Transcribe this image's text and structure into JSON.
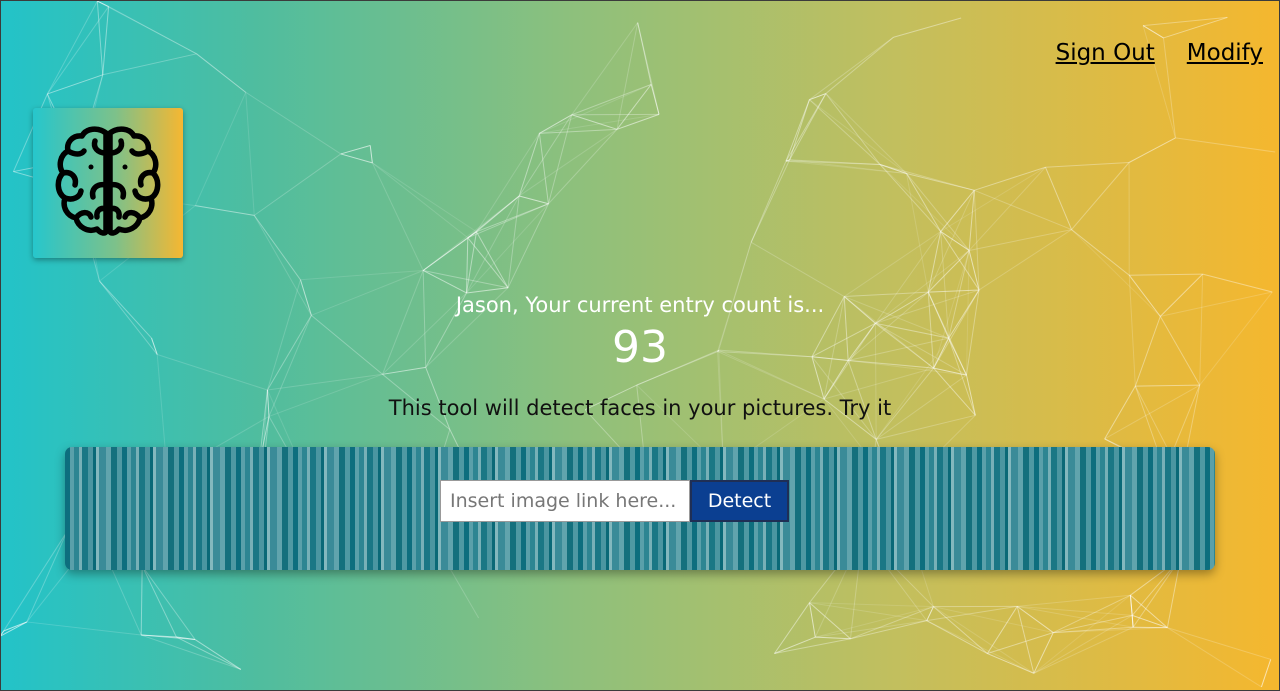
{
  "navigation": {
    "sign_out_label": "Sign Out",
    "modify_label": "Modify"
  },
  "logo": {
    "icon": "brain-icon"
  },
  "rank": {
    "message": "Jason, Your current entry count is...",
    "entries": "93"
  },
  "description": "This tool will detect faces in your pictures. Try it",
  "image_form": {
    "placeholder": "Insert image link here...",
    "value": "",
    "button_label": "Detect"
  },
  "colors": {
    "gradient_start": "#22c3c9",
    "gradient_end": "#f5b72e",
    "button": "#0b3f91"
  }
}
